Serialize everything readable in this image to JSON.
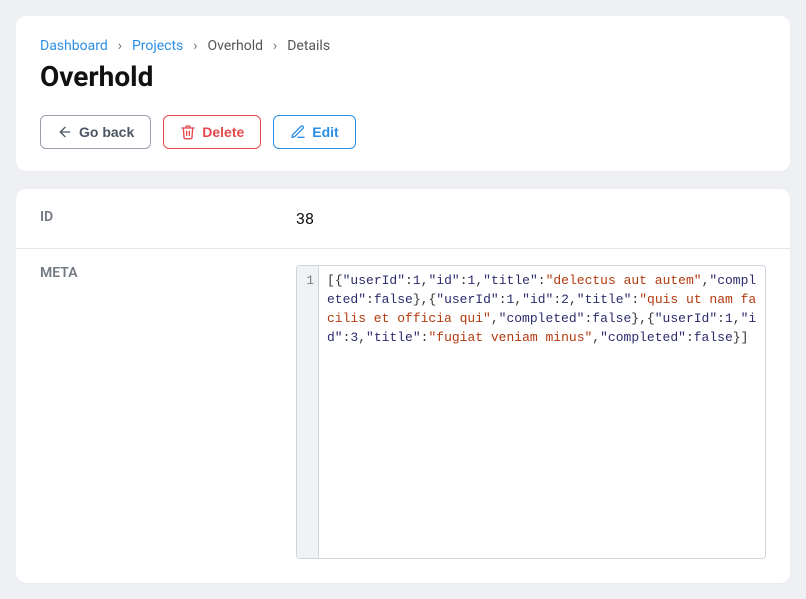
{
  "breadcrumb": {
    "items": [
      {
        "label": "Dashboard",
        "link": true
      },
      {
        "label": "Projects",
        "link": true
      },
      {
        "label": "Overhold",
        "link": false
      },
      {
        "label": "Details",
        "link": false
      }
    ]
  },
  "page": {
    "title": "Overhold"
  },
  "buttons": {
    "back": "Go back",
    "delete": "Delete",
    "edit": "Edit"
  },
  "details": {
    "id_label": "ID",
    "id_value": "38",
    "meta_label": "META",
    "meta_gutter_1": "1",
    "meta_json": [
      {
        "userId": 1,
        "id": 1,
        "title": "delectus aut autem",
        "completed": false
      },
      {
        "userId": 1,
        "id": 2,
        "title": "quis ut nam facilis et officia qui",
        "completed": false
      },
      {
        "userId": 1,
        "id": 3,
        "title": "fugiat veniam minus",
        "completed": false
      }
    ]
  }
}
